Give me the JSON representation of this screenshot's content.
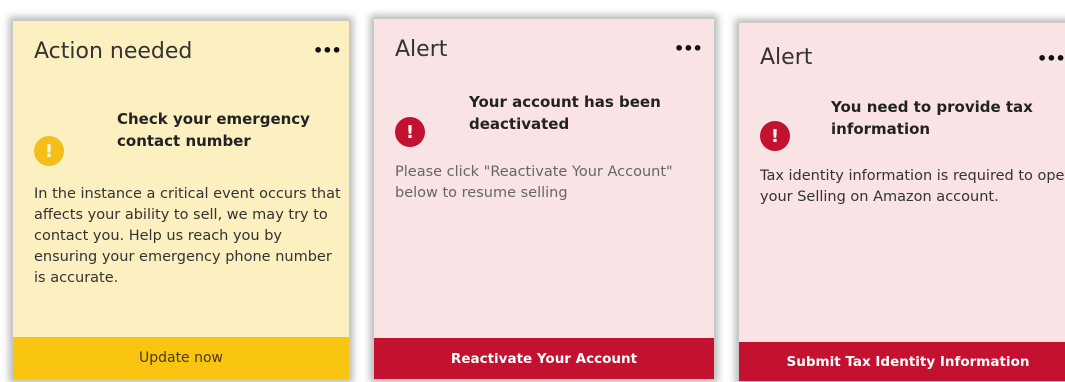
{
  "cards": [
    {
      "title": "Action needed",
      "menu_icon": "•••",
      "status_glyph": "!",
      "headline": "Check your emergency contact number",
      "body": "In the instance a critical event occurs that affects your ability to sell, we may try to contact you. Help us reach you by ensuring your emergency phone number is accurate.",
      "button_label": "Update now"
    },
    {
      "title": "Alert",
      "menu_icon": "•••",
      "status_glyph": "!",
      "headline": "Your account has been deactivated",
      "body": "Please click \"Reactivate Your Account\" below to resume selling",
      "button_label": "Reactivate Your Account"
    },
    {
      "title": "Alert",
      "menu_icon": "•••",
      "status_glyph": "!",
      "headline": "You need to provide tax information",
      "body": "Tax identity information is required to open your Selling on Amazon account.",
      "button_label": "Submit Tax Identity Information"
    }
  ],
  "colors": {
    "warning_background": "#fcefc0",
    "warning_accent": "#f5be18",
    "warning_button": "#f9c510",
    "alert_background": "#f9e3e4",
    "alert_accent": "#c4112f"
  }
}
